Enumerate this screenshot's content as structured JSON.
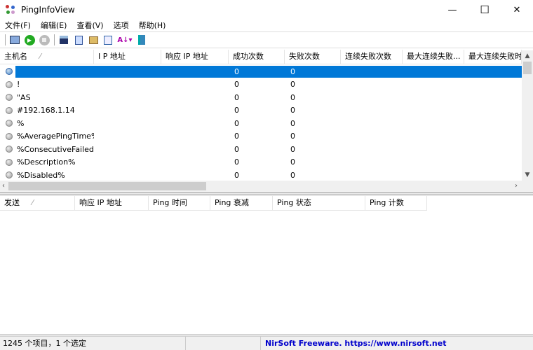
{
  "window": {
    "title": "PingInfoView",
    "minimize": "—",
    "maximize": "☐",
    "close": "✕"
  },
  "menu": [
    "文件(F)",
    "编辑(E)",
    "查看(V)",
    "选项",
    "帮助(H)"
  ],
  "toolbar": [
    "properties-icon",
    "start-icon",
    "stop-icon",
    "save-icon",
    "copy-icon",
    "html-report-icon",
    "find-icon",
    "sort-icon",
    "exit-icon"
  ],
  "upper": {
    "columns": [
      "主机名",
      "I P 地址",
      "响应 IP 地址",
      "成功次数",
      "失败次数",
      "连续失败次数",
      "最大连续失败...",
      "最大连续失败时"
    ],
    "sort_indicator": "⁄",
    "rows": [
      {
        "host": "",
        "success": "0",
        "fail": "0",
        "selected": true
      },
      {
        "host": "!",
        "success": "0",
        "fail": "0"
      },
      {
        "host": "\"AS",
        "success": "0",
        "fail": "0"
      },
      {
        "host": "#192.168.1.14",
        "success": "0",
        "fail": "0"
      },
      {
        "host": "%",
        "success": "0",
        "fail": "0"
      },
      {
        "host": "%AveragePingTime%",
        "success": "0",
        "fail": "0"
      },
      {
        "host": "%ConsecutiveFailed...",
        "success": "0",
        "fail": "0"
      },
      {
        "host": "%Description%",
        "success": "0",
        "fail": "0"
      },
      {
        "host": "%Disabled%",
        "success": "0",
        "fail": "0"
      }
    ]
  },
  "lower": {
    "columns": [
      "发送",
      "响应 IP 地址",
      "Ping 时间",
      "Ping 衰减",
      "Ping 状态",
      "Ping 计数"
    ]
  },
  "status": {
    "items": "1245 个项目，1 个选定",
    "credit": "NirSoft Freeware. https://www.nirsoft.net"
  },
  "colors": {
    "selection": "#0078d7",
    "credit": "#0000cc"
  }
}
